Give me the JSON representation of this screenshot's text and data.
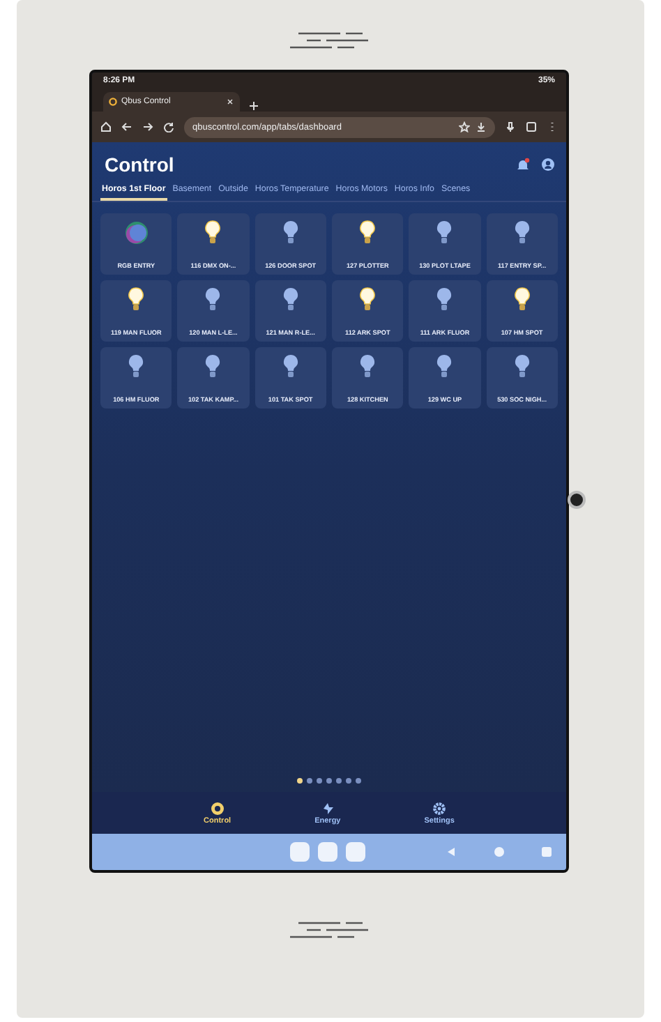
{
  "status_bar": {
    "time": "8:26 PM",
    "battery": "35%"
  },
  "browser": {
    "tab_title": "Qbus Control",
    "url": "qbuscontrol.com/app/tabs/dashboard"
  },
  "header": {
    "title": "Control"
  },
  "tabs": [
    {
      "label": "Horos 1st Floor",
      "selected": true
    },
    {
      "label": "Basement",
      "selected": false
    },
    {
      "label": "Outside",
      "selected": false
    },
    {
      "label": "Horos Temperature",
      "selected": false
    },
    {
      "label": "Horos Motors",
      "selected": false
    },
    {
      "label": "Horos Info",
      "selected": false
    },
    {
      "label": "Scenes",
      "selected": false
    }
  ],
  "tiles": [
    {
      "label": "RGB ENTRY",
      "kind": "rgb",
      "on": true
    },
    {
      "label": "116 DMX ON-...",
      "kind": "bulb",
      "on": true
    },
    {
      "label": "126 DOOR SPOT",
      "kind": "bulb",
      "on": false
    },
    {
      "label": "127 PLOTTER",
      "kind": "bulb",
      "on": true
    },
    {
      "label": "130 PLOT LTAPE",
      "kind": "bulb",
      "on": false
    },
    {
      "label": "117 ENTRY SP...",
      "kind": "bulb",
      "on": false
    },
    {
      "label": "119 MAN FLUOR",
      "kind": "bulb",
      "on": true
    },
    {
      "label": "120 MAN L-LE...",
      "kind": "bulb",
      "on": false
    },
    {
      "label": "121 MAN R-LE...",
      "kind": "bulb",
      "on": false
    },
    {
      "label": "112 ARK SPOT",
      "kind": "bulb",
      "on": true
    },
    {
      "label": "111 ARK FLUOR",
      "kind": "bulb",
      "on": false
    },
    {
      "label": "107 HM SPOT",
      "kind": "bulb",
      "on": true
    },
    {
      "label": "106 HM FLUOR",
      "kind": "bulb",
      "on": false
    },
    {
      "label": "102 TAK KAMP...",
      "kind": "bulb",
      "on": false
    },
    {
      "label": "101 TAK SPOT",
      "kind": "bulb",
      "on": false
    },
    {
      "label": "128 KITCHEN",
      "kind": "bulb",
      "on": false
    },
    {
      "label": "129 WC UP",
      "kind": "bulb",
      "on": false
    },
    {
      "label": "530 SOC NIGH...",
      "kind": "bulb",
      "on": false
    }
  ],
  "page_dots": [
    {
      "selected": true
    },
    {
      "selected": false
    },
    {
      "selected": false
    },
    {
      "selected": false
    },
    {
      "selected": false
    },
    {
      "selected": false
    },
    {
      "selected": false
    }
  ],
  "bottom_nav": [
    {
      "label": "Control",
      "kind": "control",
      "selected": true
    },
    {
      "label": "Energy",
      "kind": "energy",
      "selected": false
    },
    {
      "label": "Settings",
      "kind": "settings",
      "selected": false
    }
  ]
}
